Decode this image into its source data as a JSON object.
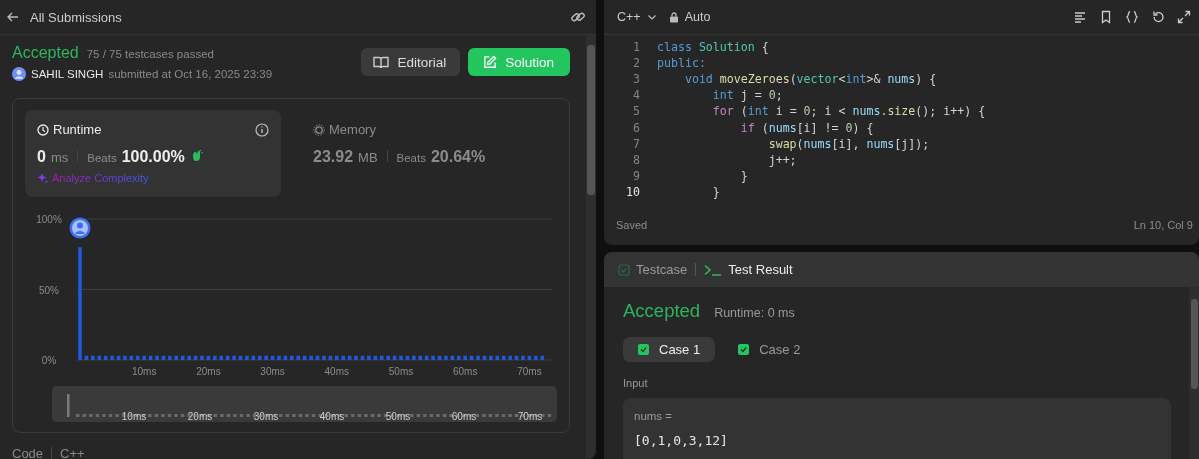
{
  "header": {
    "title": "All Submissions"
  },
  "submission": {
    "status": "Accepted",
    "testcases": "75 / 75 testcases passed",
    "author": "SAHIL SINGH",
    "submitted": "submitted at Oct 16, 2025 23:39"
  },
  "buttons": [
    {
      "label": "Editorial",
      "kind": "secondary"
    },
    {
      "label": "Solution",
      "kind": "primary"
    }
  ],
  "stats": [
    {
      "kind": "runtime",
      "label": "Runtime",
      "selected": true,
      "value": "0",
      "unit": "ms",
      "beats_label": "Beats",
      "beats": "100.00%",
      "link": "Analyze Complexity"
    },
    {
      "kind": "memory",
      "label": "Memory",
      "selected": false,
      "value": "23.92",
      "unit": "MB",
      "beats_label": "Beats",
      "beats": "20.64%"
    }
  ],
  "chart_data": {
    "type": "bar",
    "x": [
      0,
      1,
      2,
      3,
      4,
      5,
      6,
      7,
      8,
      9,
      10,
      11,
      12,
      13,
      14,
      15,
      16,
      17,
      18,
      19,
      20,
      21,
      22,
      23,
      24,
      25,
      26,
      27,
      28,
      29,
      30,
      31,
      32,
      33,
      34,
      35,
      36,
      37,
      38,
      39,
      40,
      41,
      42,
      43,
      44,
      45,
      46,
      47,
      48,
      49,
      50,
      51,
      52,
      53,
      54,
      55,
      56,
      57,
      58,
      59,
      60,
      61,
      62,
      63,
      64,
      65,
      66,
      67,
      68,
      69,
      70,
      71,
      72
    ],
    "values": [
      80,
      3,
      3,
      3,
      3,
      3,
      3,
      3,
      3,
      3,
      3,
      3,
      3,
      3,
      3,
      3,
      3,
      3,
      3,
      3,
      3,
      3,
      3,
      3,
      3,
      3,
      3,
      3,
      3,
      3,
      3,
      3,
      3,
      3,
      3,
      3,
      3,
      3,
      3,
      3,
      3,
      3,
      3,
      3,
      3,
      3,
      3,
      3,
      3,
      3,
      3,
      3,
      3,
      3,
      3,
      3,
      3,
      3,
      3,
      3,
      3,
      3,
      3,
      3,
      3,
      3,
      3,
      3,
      3,
      3,
      3,
      3,
      3
    ],
    "xlim": [
      -0.5,
      73.4
    ],
    "ylim": [
      0,
      100
    ],
    "yticks": [
      {
        "value": 0,
        "label": "0%"
      },
      {
        "value": 50,
        "label": "50%"
      },
      {
        "value": 100,
        "label": "100%"
      }
    ],
    "xticks": [
      {
        "value": 10,
        "label": "10ms"
      },
      {
        "value": 20,
        "label": "20ms"
      },
      {
        "value": 30,
        "label": "30ms"
      },
      {
        "value": 40,
        "label": "40ms"
      },
      {
        "value": 50,
        "label": "50ms"
      },
      {
        "value": 60,
        "label": "60ms"
      },
      {
        "value": 70,
        "label": "70ms"
      }
    ]
  },
  "range_selector": {
    "labels": [
      "10ms",
      "20ms",
      "30ms",
      "40ms",
      "50ms",
      "60ms",
      "70ms"
    ]
  },
  "code_section": {
    "label": "Code",
    "language": "C++"
  },
  "editor": {
    "language": "C++",
    "mode": "Auto",
    "status": "Saved",
    "cursor": "Ln 10, Col 9",
    "lines": [
      {
        "number": "1",
        "current": false,
        "tokens": [
          {
            "text": "class",
            "kind": "keyword"
          },
          {
            "text": " Solution",
            "kind": "type"
          },
          {
            "text": " {",
            "kind": "plain"
          }
        ]
      },
      {
        "number": "2",
        "current": false,
        "tokens": [
          {
            "text": "public:",
            "kind": "keyword"
          }
        ]
      },
      {
        "number": "3",
        "current": false,
        "tokens": [
          {
            "text": "    void",
            "kind": "keyword"
          },
          {
            "text": " moveZeroes",
            "kind": "function"
          },
          {
            "text": "(",
            "kind": "plain"
          },
          {
            "text": "vector",
            "kind": "type"
          },
          {
            "text": "<",
            "kind": "plain"
          },
          {
            "text": "int",
            "kind": "keyword"
          },
          {
            "text": ">& ",
            "kind": "plain"
          },
          {
            "text": "nums",
            "kind": "variable"
          },
          {
            "text": ") {",
            "kind": "plain"
          }
        ]
      },
      {
        "number": "4",
        "current": false,
        "tokens": [
          {
            "text": "        int",
            "kind": "keyword"
          },
          {
            "text": " j = ",
            "kind": "plain"
          },
          {
            "text": "0",
            "kind": "number"
          },
          {
            "text": ";",
            "kind": "plain"
          }
        ]
      },
      {
        "number": "5",
        "current": false,
        "tokens": [
          {
            "text": "        for",
            "kind": "control"
          },
          {
            "text": " (",
            "kind": "plain"
          },
          {
            "text": "int",
            "kind": "keyword"
          },
          {
            "text": " i = ",
            "kind": "plain"
          },
          {
            "text": "0",
            "kind": "number"
          },
          {
            "text": "; i < ",
            "kind": "plain"
          },
          {
            "text": "nums",
            "kind": "variable"
          },
          {
            "text": ".",
            "kind": "plain"
          },
          {
            "text": "size",
            "kind": "function"
          },
          {
            "text": "(); i++) {",
            "kind": "plain"
          }
        ]
      },
      {
        "number": "6",
        "current": false,
        "tokens": [
          {
            "text": "            if",
            "kind": "control"
          },
          {
            "text": " (",
            "kind": "plain"
          },
          {
            "text": "nums",
            "kind": "variable"
          },
          {
            "text": "[i] != ",
            "kind": "plain"
          },
          {
            "text": "0",
            "kind": "number"
          },
          {
            "text": ") {",
            "kind": "plain"
          }
        ]
      },
      {
        "number": "7",
        "current": false,
        "tokens": [
          {
            "text": "                swap",
            "kind": "function"
          },
          {
            "text": "(",
            "kind": "plain"
          },
          {
            "text": "nums",
            "kind": "variable"
          },
          {
            "text": "[i], ",
            "kind": "plain"
          },
          {
            "text": "nums",
            "kind": "variable"
          },
          {
            "text": "[j]);",
            "kind": "plain"
          }
        ]
      },
      {
        "number": "8",
        "current": false,
        "tokens": [
          {
            "text": "                j++;",
            "kind": "plain"
          }
        ]
      },
      {
        "number": "9",
        "current": false,
        "tokens": [
          {
            "text": "            }",
            "kind": "plain"
          }
        ]
      },
      {
        "number": "10",
        "current": true,
        "tokens": [
          {
            "text": "        }",
            "kind": "plain"
          }
        ]
      }
    ]
  },
  "result": {
    "tabs": [
      {
        "label": "Testcase",
        "kind": "testcase",
        "selected": false
      },
      {
        "label": "Test Result",
        "kind": "terminal",
        "selected": true
      }
    ],
    "status": "Accepted",
    "runtime": "Runtime: 0 ms",
    "cases": [
      {
        "label": "Case 1",
        "selected": true
      },
      {
        "label": "Case 2",
        "selected": false
      }
    ],
    "input_label": "Input",
    "inputs": [
      {
        "name": "nums =",
        "value": "[0,1,0,3,12]"
      }
    ]
  }
}
